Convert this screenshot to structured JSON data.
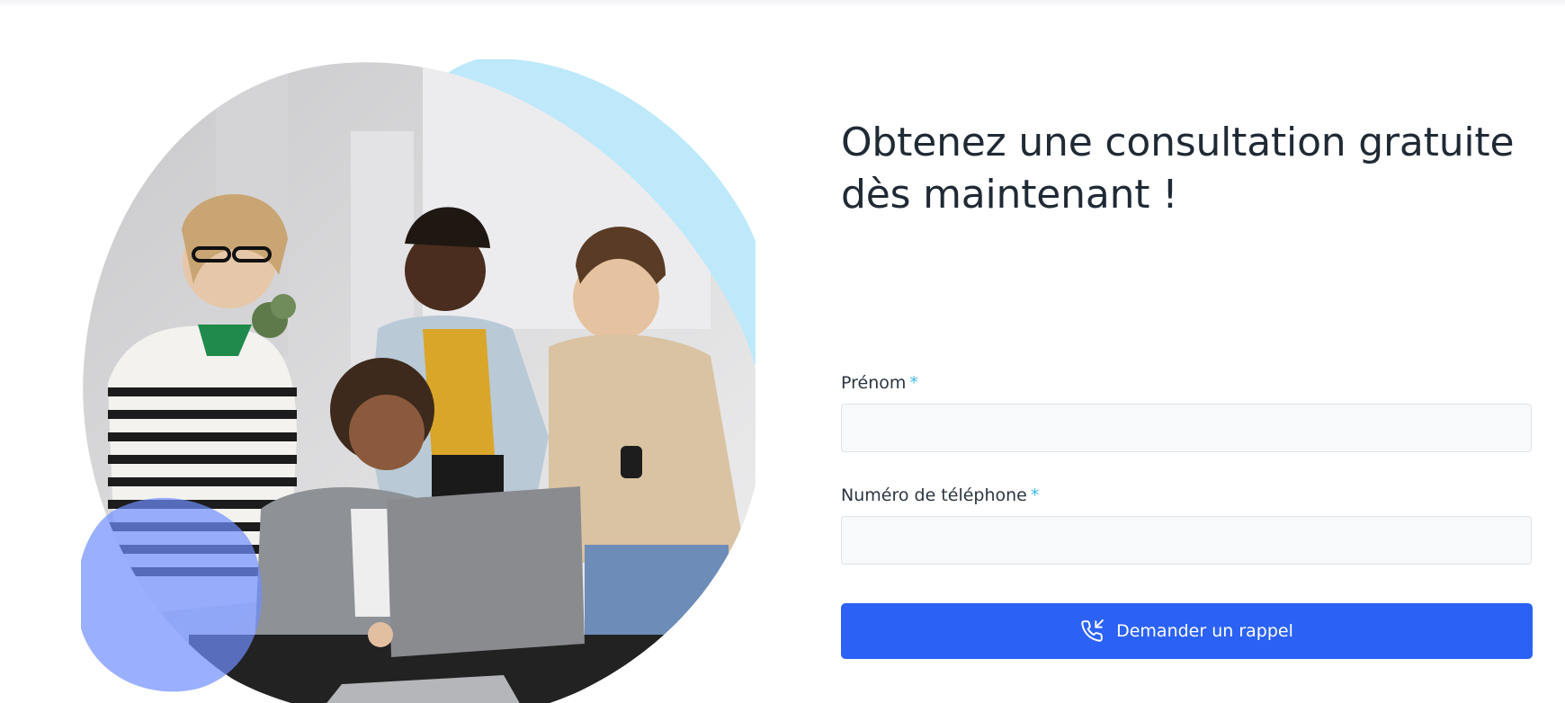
{
  "header": {
    "title": "Obtenez une consultation gratuite dès maintenant !"
  },
  "form": {
    "first_name": {
      "label": "Prénom",
      "required_mark": "*",
      "value": "",
      "placeholder": ""
    },
    "phone": {
      "label": "Numéro de téléphone",
      "required_mark": "*",
      "value": "",
      "placeholder": ""
    },
    "submit_label": "Demander un rappel",
    "submit_icon": "phone-callback-icon"
  },
  "hero": {
    "image": "team-collaboration-photo",
    "decor_colors": {
      "light_blue_blob": "#bde9fb",
      "blue_blob": "#7c9bff"
    }
  },
  "colors": {
    "accent": "#2b62f5",
    "required": "#3fb9e4",
    "heading": "#1f2a35"
  }
}
